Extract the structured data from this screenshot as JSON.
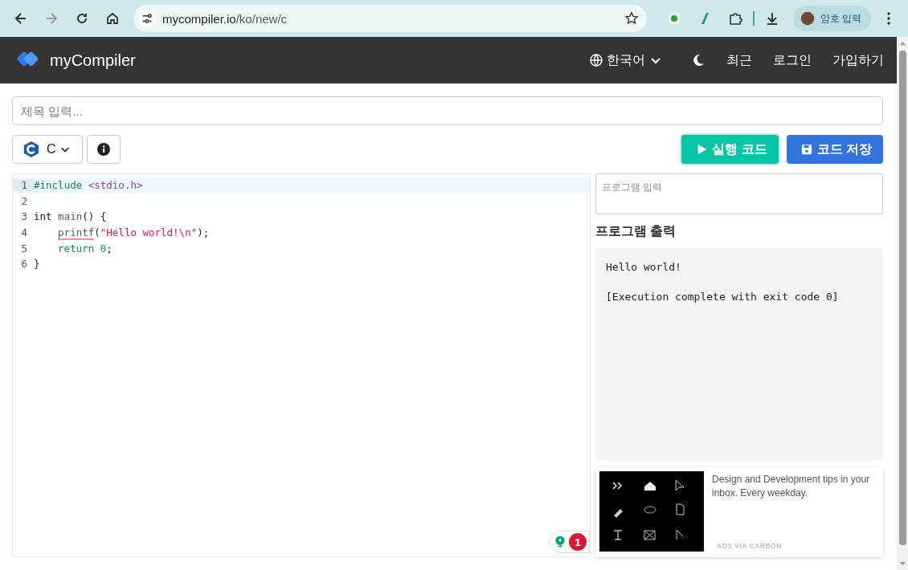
{
  "browser": {
    "url_host": "mycompiler.io",
    "url_path": "/ko/new/c",
    "profile_label": "암호 입력"
  },
  "navbar": {
    "brand": "myCompiler",
    "language": "한국어",
    "links": [
      "최근",
      "로그인",
      "가입하기"
    ]
  },
  "title_field": {
    "placeholder": "제목 입력..."
  },
  "toolbar": {
    "language": "C",
    "run_button": "실행 코드",
    "save_button": "코드 저장"
  },
  "editor": {
    "lines": [
      {
        "number": "1",
        "selected": true,
        "indented": false,
        "tokens": [
          {
            "text": "#include ",
            "kind": "preproc",
            "squiggle": false
          },
          {
            "text": "<stdio.h>",
            "kind": "header",
            "squiggle": false
          }
        ]
      },
      {
        "number": "2",
        "selected": false
      },
      {
        "number": "3",
        "selected": false,
        "indented": false,
        "tokens": [
          {
            "text": "int ",
            "kind": "plain",
            "squiggle": false
          },
          {
            "text": "main",
            "kind": "func",
            "squiggle": false
          },
          {
            "text": "() {",
            "kind": "plain",
            "squiggle": false
          }
        ]
      },
      {
        "number": "4",
        "selected": false,
        "indented": true,
        "tokens": [
          {
            "text": "printf",
            "kind": "func",
            "squiggle": true
          },
          {
            "text": "(",
            "kind": "plain",
            "squiggle": false
          },
          {
            "text": "\"Hello world!\\n\"",
            "kind": "string",
            "squiggle": false
          },
          {
            "text": ");",
            "kind": "plain",
            "squiggle": false
          }
        ]
      },
      {
        "number": "5",
        "selected": false,
        "indented": true,
        "tokens": [
          {
            "text": "return ",
            "kind": "keyword",
            "squiggle": false
          },
          {
            "text": "0",
            "kind": "number",
            "squiggle": false
          },
          {
            "text": ";",
            "kind": "plain",
            "squiggle": false
          }
        ]
      },
      {
        "number": "6",
        "selected": false,
        "indented": false,
        "tokens": [
          {
            "text": "}",
            "kind": "plain",
            "squiggle": false
          }
        ]
      }
    ],
    "hint_badge": "1"
  },
  "stdin": {
    "placeholder": "프로그램 입력"
  },
  "output": {
    "heading": "프로그램 출력",
    "lines": [
      "Hello world!",
      "[Execution complete with exit code 0]"
    ]
  },
  "ad": {
    "text": "Design and Development tips in your inbox. Every weekday.",
    "attribution": "ADS VIA CARBON"
  }
}
